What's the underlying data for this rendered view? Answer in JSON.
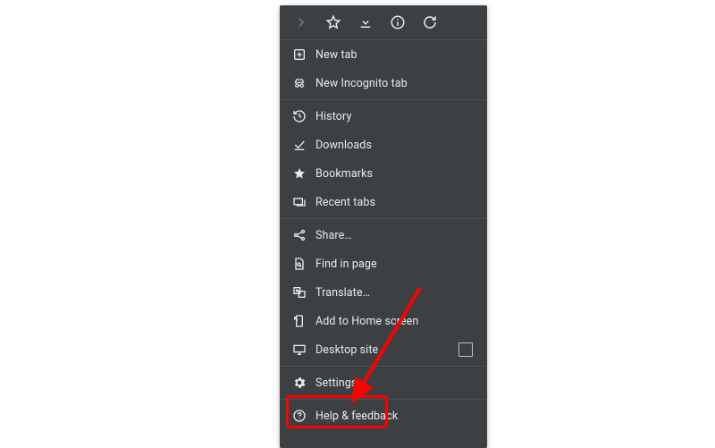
{
  "colors": {
    "panel_bg": "#3c4043",
    "text": "#e8eaed",
    "divider": "#4e5256",
    "highlight": "#ff0000"
  },
  "toolbar": {
    "items": [
      {
        "name": "forward-icon",
        "interactable": false
      },
      {
        "name": "star-icon",
        "interactable": true
      },
      {
        "name": "download-toolbar-icon",
        "interactable": true
      },
      {
        "name": "info-icon",
        "interactable": true
      },
      {
        "name": "refresh-icon",
        "interactable": true
      }
    ]
  },
  "menu": {
    "groups": [
      {
        "items": [
          {
            "icon": "plus-square-icon",
            "label": "New tab",
            "name": "menu-new-tab"
          },
          {
            "icon": "incognito-icon",
            "label": "New Incognito tab",
            "name": "menu-new-incognito-tab"
          }
        ]
      },
      {
        "items": [
          {
            "icon": "history-icon",
            "label": "History",
            "name": "menu-history"
          },
          {
            "icon": "download-done-icon",
            "label": "Downloads",
            "name": "menu-downloads"
          },
          {
            "icon": "bookmark-star-icon",
            "label": "Bookmarks",
            "name": "menu-bookmarks"
          },
          {
            "icon": "recent-tabs-icon",
            "label": "Recent tabs",
            "name": "menu-recent-tabs"
          }
        ]
      },
      {
        "items": [
          {
            "icon": "share-icon",
            "label": "Share…",
            "name": "menu-share"
          },
          {
            "icon": "find-in-page-icon",
            "label": "Find in page",
            "name": "menu-find-in-page"
          },
          {
            "icon": "translate-icon",
            "label": "Translate…",
            "name": "menu-translate"
          },
          {
            "icon": "add-to-home-icon",
            "label": "Add to Home screen",
            "name": "menu-add-to-home"
          },
          {
            "icon": "desktop-icon",
            "label": "Desktop site",
            "name": "menu-desktop-site",
            "checkbox": true,
            "checked": false
          }
        ]
      },
      {
        "items": [
          {
            "icon": "gear-icon",
            "label": "Settings",
            "name": "menu-settings",
            "highlighted": true
          }
        ]
      },
      {
        "items": [
          {
            "icon": "help-icon",
            "label": "Help & feedback",
            "name": "menu-help-feedback"
          }
        ]
      }
    ]
  }
}
